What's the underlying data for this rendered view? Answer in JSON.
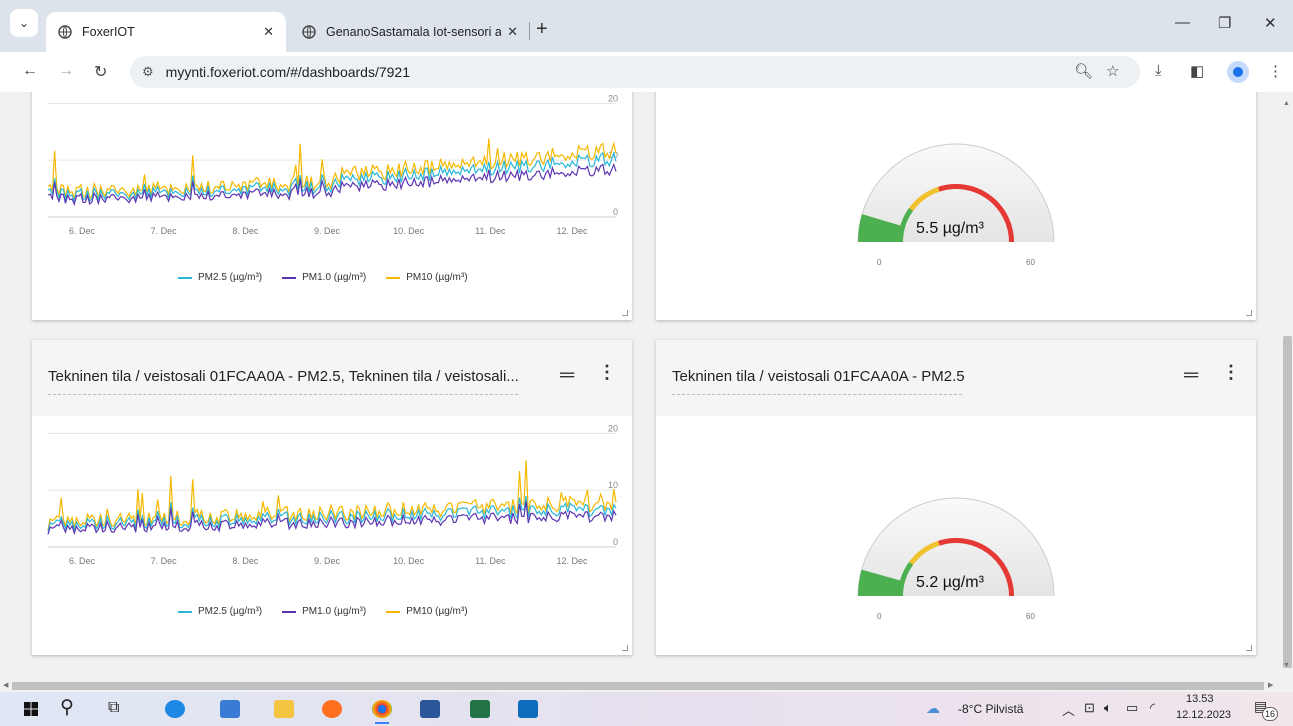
{
  "browser": {
    "tabs": [
      {
        "title": "FoxerIOT",
        "active": true
      },
      {
        "title": "GenanoSastamala Iot-sensori ar",
        "active": false
      }
    ],
    "url": "myynti.foxeriot.com/#/dashboards/7921"
  },
  "colors": {
    "pm25": "#29b6d8",
    "pm10_ug": "#5e35b1",
    "pm10": "#f5b800",
    "gauge_green": "#4caf50",
    "gauge_yellow": "#f2c12e",
    "gauge_red": "#e53935"
  },
  "cards": {
    "top_left": {
      "chart_data": {
        "type": "line",
        "x_ticks": [
          "6. Dec",
          "7. Dec",
          "8. Dec",
          "9. Dec",
          "10. Dec",
          "11. Dec",
          "12. Dec"
        ],
        "y_ticks": [
          "0",
          "10",
          "20"
        ],
        "ylim": [
          0,
          22
        ],
        "series": [
          {
            "name": "PM2.5 (µg/m³)",
            "color": "#29b6d8"
          },
          {
            "name": "PM1.0 (µg/m³)",
            "color": "#5e35b1"
          },
          {
            "name": "PM10 (µg/m³)",
            "color": "#f5b800"
          }
        ]
      }
    },
    "top_right": {
      "gauge": {
        "value_label": "5.5 µg/m³",
        "value": 5.5,
        "min": "0",
        "max": "60"
      }
    },
    "bottom_left": {
      "title": "Tekninen tila / veistosali 01FCAA0A - PM2.5, Tekninen tila / veistosali...",
      "chart_data": {
        "type": "line",
        "x_ticks": [
          "6. Dec",
          "7. Dec",
          "8. Dec",
          "9. Dec",
          "10. Dec",
          "11. Dec",
          "12. Dec"
        ],
        "y_ticks": [
          "0",
          "10",
          "20"
        ],
        "ylim": [
          0,
          22
        ],
        "series": [
          {
            "name": "PM2.5 (µg/m³)",
            "color": "#29b6d8"
          },
          {
            "name": "PM1.0 (µg/m³)",
            "color": "#5e35b1"
          },
          {
            "name": "PM10 (µg/m³)",
            "color": "#f5b800"
          }
        ]
      }
    },
    "bottom_right": {
      "title": "Tekninen tila / veistosali 01FCAA0A - PM2.5",
      "gauge": {
        "value_label": "5.2 µg/m³",
        "value": 5.2,
        "min": "0",
        "max": "60"
      }
    }
  },
  "taskbar": {
    "weather": "-8°C Pilvistä",
    "time": "13.53",
    "date": "12.12.2023",
    "notifications": "16"
  }
}
